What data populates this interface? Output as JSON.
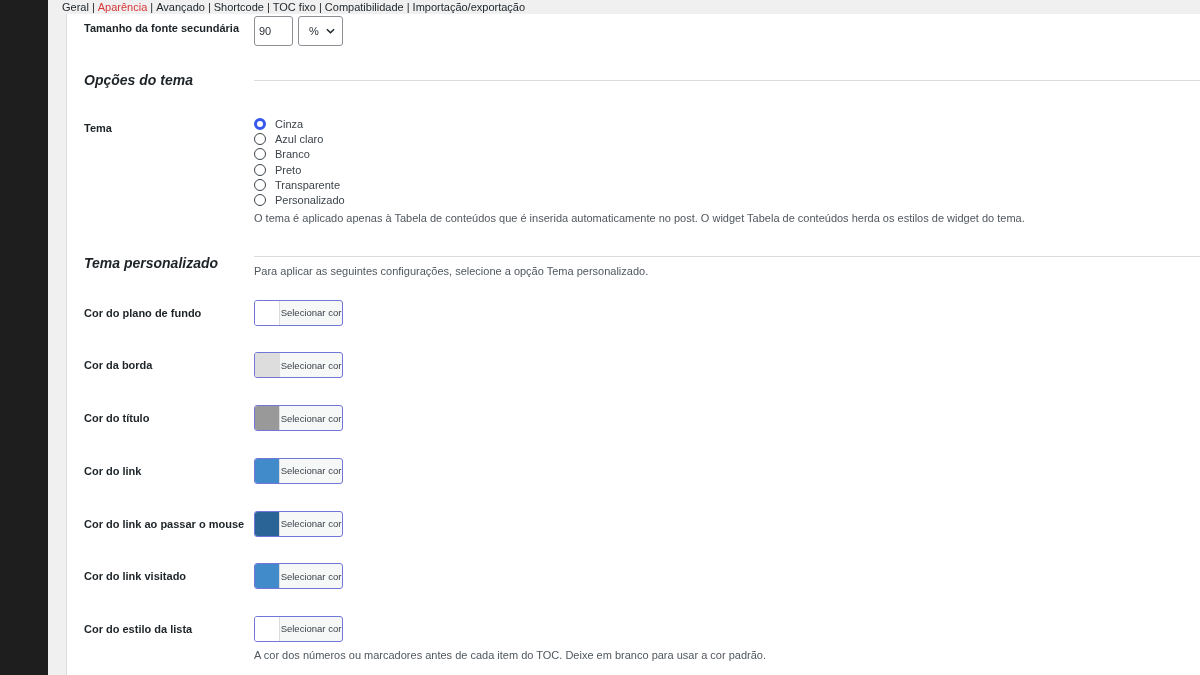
{
  "nav": {
    "separator": "|",
    "tabs": [
      {
        "label": "Geral",
        "selected": false
      },
      {
        "label": "Aparência",
        "selected": true
      },
      {
        "label": "Avançado",
        "selected": false
      },
      {
        "label": "Shortcode",
        "selected": false
      },
      {
        "label": "TOC fixo",
        "selected": false
      },
      {
        "label": "Compatibilidade",
        "selected": false
      },
      {
        "label": "Importação/exportação",
        "selected": false
      }
    ]
  },
  "font_size": {
    "label": "Tamanho da fonte secundária",
    "value": "90",
    "unit": "%"
  },
  "theme_options": {
    "heading": "Opções do tema",
    "label": "Tema",
    "options": [
      {
        "label": "Cinza",
        "selected": true
      },
      {
        "label": "Azul claro",
        "selected": false
      },
      {
        "label": "Branco",
        "selected": false
      },
      {
        "label": "Preto",
        "selected": false
      },
      {
        "label": "Transparente",
        "selected": false
      },
      {
        "label": "Personalizado",
        "selected": false
      }
    ],
    "description": "O tema é aplicado apenas à Tabela de conteúdos que é inserida automaticamente no post. O widget Tabela de conteúdos herda os estilos de widget do tema."
  },
  "custom_theme": {
    "heading": "Tema personalizado",
    "description": "Para aplicar as seguintes configurações, selecione a opção Tema personalizado.",
    "colors": [
      {
        "label": "Cor do plano de fundo",
        "button": "Selecionar cor",
        "color": "#ffffff"
      },
      {
        "label": "Cor da borda",
        "button": "Selecionar cor",
        "color": "#dddddd"
      },
      {
        "label": "Cor do título",
        "button": "Selecionar cor",
        "color": "#999999"
      },
      {
        "label": "Cor do link",
        "button": "Selecionar cor",
        "color": "#428bca"
      },
      {
        "label": "Cor do link ao passar o mouse",
        "button": "Selecionar cor",
        "color": "#2a6496"
      },
      {
        "label": "Cor do link visitado",
        "button": "Selecionar cor",
        "color": "#428bca"
      },
      {
        "label": "Cor do estilo da lista",
        "button": "Selecionar cor",
        "color": "#ffffff",
        "description": "A cor dos números ou marcadores antes de cada item do TOC. Deixe em branco para usar a cor padrão."
      }
    ]
  }
}
